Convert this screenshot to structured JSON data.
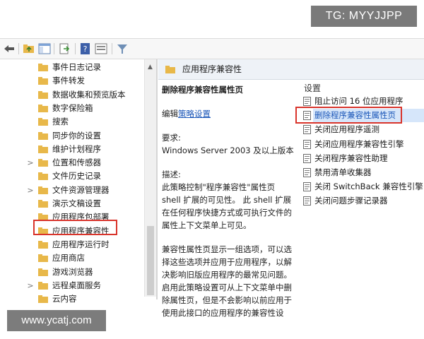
{
  "watermark_top": "TG: MYYJJPP",
  "watermark_bottom": "www.ycatj.com",
  "toolbar": {
    "icons": [
      "back-arrow-icon",
      "folder-up-icon",
      "show-hide-tree-icon",
      "export-list-icon",
      "help-icon",
      "view-icon",
      "filter-icon"
    ]
  },
  "tree": {
    "items": [
      {
        "label": "事件日志记录",
        "chev": ""
      },
      {
        "label": "事件转发",
        "chev": ""
      },
      {
        "label": "数据收集和预览版本",
        "chev": ""
      },
      {
        "label": "数字保险箱",
        "chev": ""
      },
      {
        "label": "搜索",
        "chev": ""
      },
      {
        "label": "同步你的设置",
        "chev": ""
      },
      {
        "label": "维护计划程序",
        "chev": ""
      },
      {
        "label": "位置和传感器",
        "chev": ">"
      },
      {
        "label": "文件历史记录",
        "chev": ""
      },
      {
        "label": "文件资源管理器",
        "chev": ">"
      },
      {
        "label": "演示文稿设置",
        "chev": ""
      },
      {
        "label": "应用程序包部署",
        "chev": ""
      },
      {
        "label": "应用程序兼容性",
        "chev": "",
        "selected": true
      },
      {
        "label": "应用程序运行时",
        "chev": ""
      },
      {
        "label": "应用商店",
        "chev": ""
      },
      {
        "label": "游戏浏览器",
        "chev": ""
      },
      {
        "label": "远程桌面服务",
        "chev": ">"
      },
      {
        "label": "云内容",
        "chev": ""
      }
    ]
  },
  "right": {
    "header": "应用程序兼容性",
    "desc": {
      "title": "删除程序兼容性属性页",
      "edit_prefix": "编辑",
      "edit_link": "策略设置",
      "req_label": "要求:",
      "req_value": "Windows Server 2003 及以上版本",
      "d_label": "描述:",
      "d_body": "此策略控制\"程序兼容性\"属性页 shell 扩展的可见性。 此 shell 扩展在任何程序快捷方式或可执行文件的属性上下文菜单上可见。",
      "d_body2": "兼容性属性页显示一组选项，可以选择这些选项并应用于应用程序，以解决影响旧版应用程序的最常见问题。启用此策略设置可从上下文菜单中删除属性页，但是不会影响以前应用于使用此接口的应用程序的兼容性设"
    },
    "settings": {
      "header": "设置",
      "items": [
        {
          "label": "阻止访问 16 位应用程序"
        },
        {
          "label": "删除程序兼容性属性页",
          "selected": true
        },
        {
          "label": "关闭应用程序遥测"
        },
        {
          "label": "关闭应用程序兼容性引擎"
        },
        {
          "label": "关闭程序兼容性助理"
        },
        {
          "label": "禁用清单收集器"
        },
        {
          "label": "关闭 SwitchBack 兼容性引擎"
        },
        {
          "label": "关闭问题步骤记录器"
        }
      ]
    }
  },
  "colors": {
    "highlight_border": "#d9342b",
    "link": "#1a56b8",
    "selection_fill": "#d6e6fa",
    "folder": "#e8b84a"
  }
}
